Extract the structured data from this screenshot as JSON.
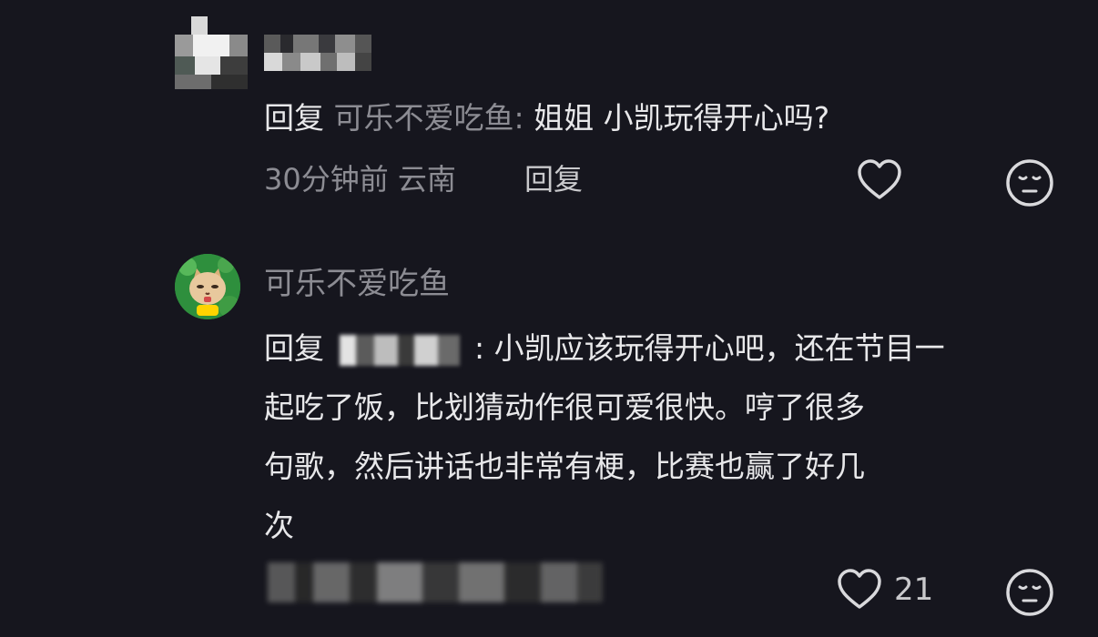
{
  "comment_1": {
    "reply_prefix": "回复",
    "reply_to": "可乐不爱吃鱼:",
    "reply_text": "姐姐 小凯玩得开心吗?",
    "time": "30分钟前",
    "location": "云南",
    "reply_action": "回复"
  },
  "comment_2": {
    "author": "可乐不爱吃鱼",
    "reply_prefix": "回复",
    "line_1_text": ": 小凯应该玩得开心吧，还在节目一",
    "line_2": "起吃了饭，比划猜动作很可爱很快。哼了很多",
    "line_3": "句歌，然后讲话也非常有梗，比赛也赢了好几",
    "line_4": "次",
    "like_count": "21"
  },
  "icons": {
    "like": "heart-outline-icon",
    "emoji": "neutral-face-icon"
  },
  "colors": {
    "background": "#16161e",
    "primary_text": "#e8e8ea",
    "secondary_text": "#8c8c93",
    "icon": "#d9d9dc"
  }
}
